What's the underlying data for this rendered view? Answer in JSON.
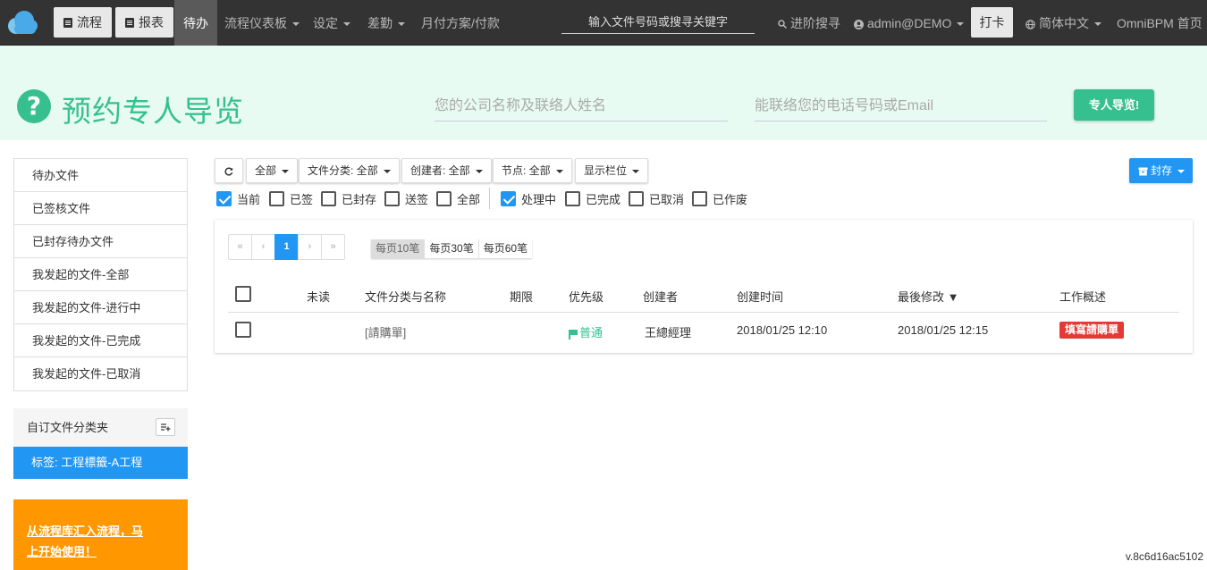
{
  "nav": {
    "logo_icon": "cloud-logo",
    "flow_button": "流程",
    "report_button": "报表",
    "active_tab": "待办",
    "links": [
      {
        "label": "流程仪表板",
        "dropdown": true
      },
      {
        "label": "设定",
        "dropdown": true
      },
      {
        "label": "差勤",
        "dropdown": true
      },
      {
        "label": "月付方案/付款",
        "dropdown": false
      }
    ],
    "search_placeholder": "输入文件号码或搜寻关键字",
    "advanced_search": "进阶搜寻",
    "user": "admin@DEMO",
    "punch": "打卡",
    "language": "简体中文",
    "home": "OmniBPM 首页"
  },
  "banner": {
    "title": "预约专人导览",
    "company_placeholder": "您的公司名称及联络人姓名",
    "contact_placeholder": "能联络您的电话号码或Email",
    "button": "专人导览!"
  },
  "sidebar": {
    "items": [
      "待办文件",
      "已签核文件",
      "已封存待办文件",
      "我发起的文件-全部",
      "我发起的文件-进行中",
      "我发起的文件-已完成",
      "我发起的文件-已取消"
    ],
    "category_title": "自订文件分类夹",
    "category_item": "标签: 工程標籤-A工程",
    "promo_line1": "从流程库汇入流程，马",
    "promo_line2": "上开始使用！"
  },
  "filters": {
    "buttons": [
      "全部",
      "文件分类: 全部",
      "创建者: 全部",
      "节点: 全部",
      "显示栏位"
    ],
    "archive": "封存",
    "checks": [
      {
        "label": "当前",
        "checked": true
      },
      {
        "label": "已签",
        "checked": false
      },
      {
        "label": "已封存",
        "checked": false
      },
      {
        "label": "送签",
        "checked": false
      },
      {
        "label": "全部",
        "checked": false
      },
      {
        "label": "处理中",
        "checked": true
      },
      {
        "label": "已完成",
        "checked": false
      },
      {
        "label": "已取消",
        "checked": false
      },
      {
        "label": "已作废",
        "checked": false
      }
    ]
  },
  "pagination": {
    "first": "«",
    "prev": "‹",
    "current": "1",
    "next": "›",
    "last": "»",
    "page_sizes": [
      "每页10笔",
      "每页30笔",
      "每页60笔"
    ],
    "selected_size": "每页10笔"
  },
  "table": {
    "headers": [
      "未读",
      "文件分类与名称",
      "期限",
      "优先级",
      "创建者",
      "创建时间",
      "最後修改 ▼",
      "工作概述"
    ],
    "rows": [
      {
        "unread": "",
        "name": "[請購單]",
        "deadline": "",
        "priority": "普通",
        "creator": "王總經理",
        "created": "2018/01/25 12:10",
        "modified": "2018/01/25 12:15",
        "task": "填寫請購單"
      }
    ]
  },
  "colors": {
    "nav_bg": "#333333",
    "accent_green": "#36c090",
    "primary_blue": "#2196f3",
    "promo_orange": "#ff9800",
    "task_red": "#e53935"
  },
  "version": "v.8c6d16ac5102"
}
